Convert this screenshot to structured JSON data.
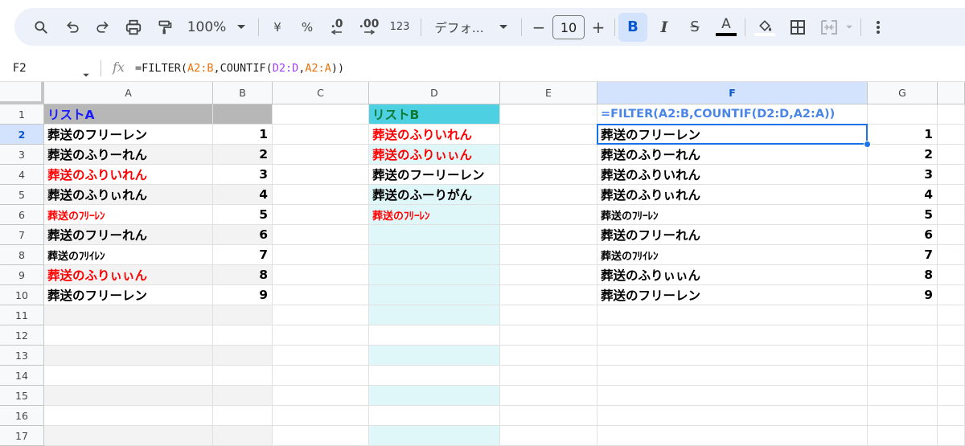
{
  "toolbar": {
    "zoom": "100%",
    "currency": "¥",
    "percent": "%",
    "decrease_decimal": ".0",
    "increase_decimal": ".00",
    "number_format": "123",
    "font": "デフォ...",
    "font_size": "10",
    "minus": "−",
    "plus": "+",
    "bold": "B",
    "italic": "I",
    "strikethrough": "S",
    "text_color": "A"
  },
  "formula_bar": {
    "cell_ref": "F2",
    "fx": "fx",
    "formula_parts": [
      "=FILTER(",
      "A2:B",
      ",COUNTIF(",
      "D2:D",
      ",",
      "A2:A",
      "))"
    ]
  },
  "columns": [
    "A",
    "B",
    "C",
    "D",
    "E",
    "F",
    "G"
  ],
  "rows": [
    "1",
    "2",
    "3",
    "4",
    "5",
    "6",
    "7",
    "8",
    "9",
    "10",
    "11",
    "12",
    "13",
    "14",
    "15",
    "16",
    "17"
  ],
  "list_a": {
    "header": "リストA",
    "names": [
      "葬送のフリーレン",
      "葬送のふりーれん",
      "葬送のふりいれん",
      "葬送のふりぃれん",
      "葬送のﾌﾘｰﾚﾝ",
      "葬送のフリーれん",
      "葬送のﾌﾘｲﾚﾝ",
      "葬送のふりぃぃん",
      "葬送のフリーレン"
    ],
    "numbers": [
      "1",
      "2",
      "3",
      "4",
      "5",
      "6",
      "7",
      "8",
      "9"
    ]
  },
  "list_b": {
    "header": "リストB",
    "names": [
      "葬送のふりいれん",
      "葬送のふりぃぃん",
      "葬送のフーリーレン",
      "葬送のふーりがん",
      "葬送のﾌﾘｰﾚﾝ"
    ]
  },
  "result": {
    "formula": "=FILTER(A2:B,COUNTIF(D2:D,A2:A))",
    "names": [
      "葬送のフリーレン",
      "葬送のふりーれん",
      "葬送のふりいれん",
      "葬送のふりぃれん",
      "葬送のﾌﾘｰﾚﾝ",
      "葬送のフリーれん",
      "葬送のﾌﾘｲﾚﾝ",
      "葬送のふりぃぃん",
      "葬送のフリーレン"
    ],
    "numbers": [
      "1",
      "2",
      "3",
      "4",
      "5",
      "6",
      "7",
      "8",
      "9"
    ]
  },
  "colors": {
    "header_a_bg": "#b7b7b7",
    "header_a_text": "#1a1aff",
    "header_b_bg": "#4dd0e1",
    "header_b_text": "#0f7a35",
    "red_text": "#ff0000",
    "formula_text": "#4a86e8",
    "selection": "#1a73e8"
  },
  "icons": [
    "search-icon",
    "undo-icon",
    "redo-icon",
    "print-icon",
    "paint-format-icon",
    "chevron-down-icon",
    "fill-color-icon",
    "borders-icon",
    "merge-cells-icon",
    "more-vert-icon"
  ]
}
